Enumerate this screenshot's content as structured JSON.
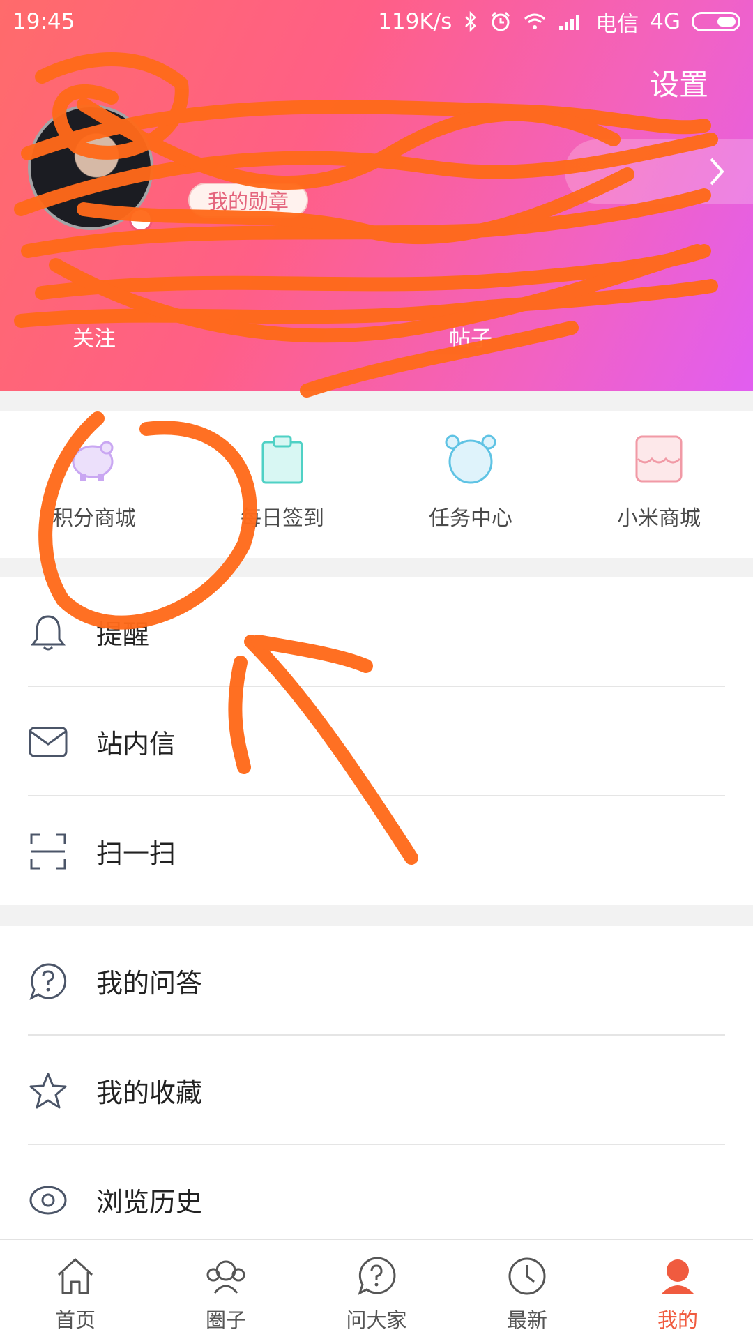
{
  "status_bar": {
    "time": "19:45",
    "speed": "119K/s",
    "carrier": "电信",
    "network": "4G",
    "icons": [
      "bluetooth-icon",
      "alarm-icon",
      "wifi-icon",
      "signal-icon",
      "battery-icon"
    ]
  },
  "header": {
    "settings_label": "设置",
    "medal_label": "我的勋章",
    "stats": [
      {
        "label": "关注"
      },
      {
        "label": "帖子"
      }
    ]
  },
  "quick_entries": [
    {
      "label": "积分商城",
      "icon": "piggy-bank-icon",
      "color": "#c9a7f2"
    },
    {
      "label": "每日签到",
      "icon": "clipboard-icon",
      "color": "#4fd1c5"
    },
    {
      "label": "任务中心",
      "icon": "bear-face-icon",
      "color": "#5fc3e4"
    },
    {
      "label": "小米商城",
      "icon": "store-icon",
      "color": "#f19aa6"
    }
  ],
  "menu_group_1": [
    {
      "label": "提醒",
      "icon": "bell-icon"
    },
    {
      "label": "站内信",
      "icon": "mail-icon"
    },
    {
      "label": "扫一扫",
      "icon": "scan-icon"
    }
  ],
  "menu_group_2": [
    {
      "label": "我的问答",
      "icon": "question-bubble-icon"
    },
    {
      "label": "我的收藏",
      "icon": "star-icon"
    },
    {
      "label": "浏览历史",
      "icon": "eye-icon"
    }
  ],
  "tabbar": [
    {
      "label": "首页",
      "icon": "home-icon",
      "active": false
    },
    {
      "label": "圈子",
      "icon": "group-icon",
      "active": false
    },
    {
      "label": "问大家",
      "icon": "question-icon",
      "active": false
    },
    {
      "label": "最新",
      "icon": "clock-icon",
      "active": false
    },
    {
      "label": "我的",
      "icon": "profile-icon",
      "active": true
    }
  ],
  "colors": {
    "accent": "#f05b3f",
    "header_gradient_start": "#ff6b6b",
    "header_gradient_end": "#e15ef0",
    "scribble": "#ff6a1a"
  }
}
